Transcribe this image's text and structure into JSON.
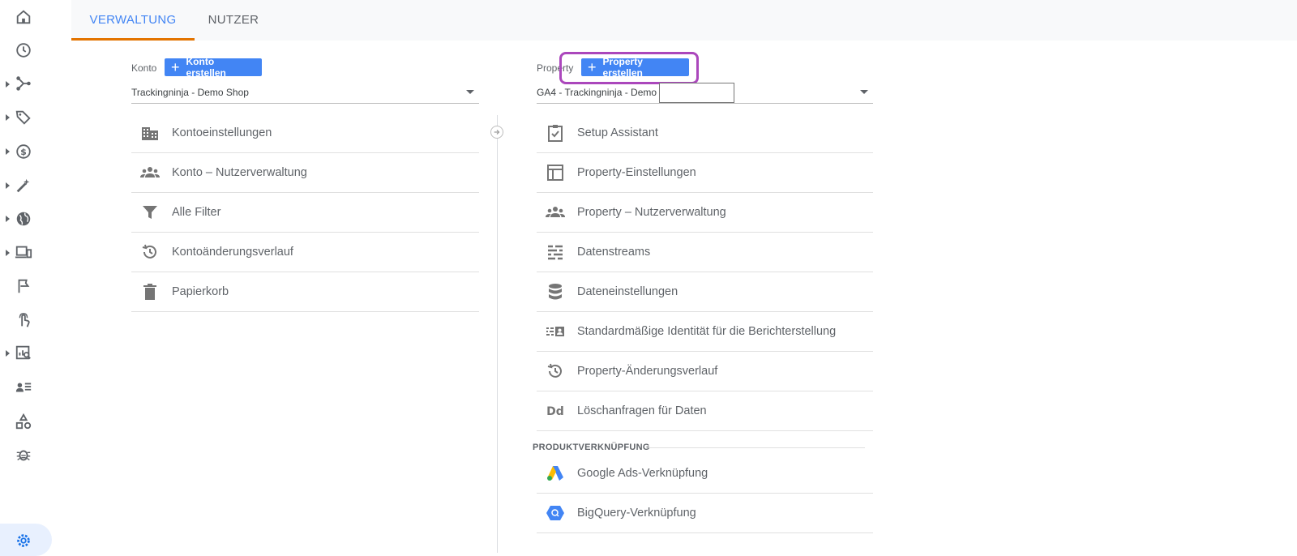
{
  "tabs": [
    {
      "label": "VERWALTUNG",
      "active": true
    },
    {
      "label": "NUTZER",
      "active": false
    }
  ],
  "nav": {
    "icons": [
      "home-icon",
      "clock-icon",
      "acquisition-icon",
      "tag-icon",
      "dollar-icon",
      "magic-wand-icon",
      "globe-icon",
      "devices-icon",
      "flag-icon",
      "touch-icon",
      "report-search-icon",
      "user-list-icon",
      "shapes-icon",
      "bug-icon",
      "settings-icon"
    ]
  },
  "account": {
    "label": "Konto",
    "create_button": "Konto erstellen",
    "selected": "Trackingninja - Demo Shop",
    "items": [
      {
        "label": "Kontoeinstellungen",
        "icon": "building-icon"
      },
      {
        "label": "Konto – Nutzerverwaltung",
        "icon": "people-icon"
      },
      {
        "label": "Alle Filter",
        "icon": "filter-icon"
      },
      {
        "label": "Kontoänderungsverlauf",
        "icon": "history-icon"
      },
      {
        "label": "Papierkorb",
        "icon": "trash-icon"
      }
    ]
  },
  "property": {
    "label": "Property",
    "create_button": "Property erstellen",
    "selected": "GA4 - Trackingninja - Demo Shop",
    "items": [
      {
        "label": "Setup Assistant",
        "icon": "clipboard-check-icon"
      },
      {
        "label": "Property-Einstellungen",
        "icon": "layout-icon"
      },
      {
        "label": "Property – Nutzerverwaltung",
        "icon": "people-icon"
      },
      {
        "label": "Datenstreams",
        "icon": "streams-icon"
      },
      {
        "label": "Dateneinstellungen",
        "icon": "database-icon"
      },
      {
        "label": "Standardmäßige Identität für die Berichterstellung",
        "icon": "identity-icon"
      },
      {
        "label": "Property-Änderungsverlauf",
        "icon": "history-icon"
      },
      {
        "label": "Löschanfragen für Daten",
        "icon": "dd-icon"
      }
    ],
    "section_heading": "PRODUKTVERKNÜPFUNG",
    "links": [
      {
        "label": "Google Ads-Verknüpfung",
        "icon": "google-ads-icon"
      },
      {
        "label": "BigQuery-Verknüpfung",
        "icon": "bigquery-icon"
      }
    ]
  },
  "colors": {
    "accent": "#4285f4",
    "tab_underline": "#e37400",
    "highlight": "#ab47bc"
  }
}
